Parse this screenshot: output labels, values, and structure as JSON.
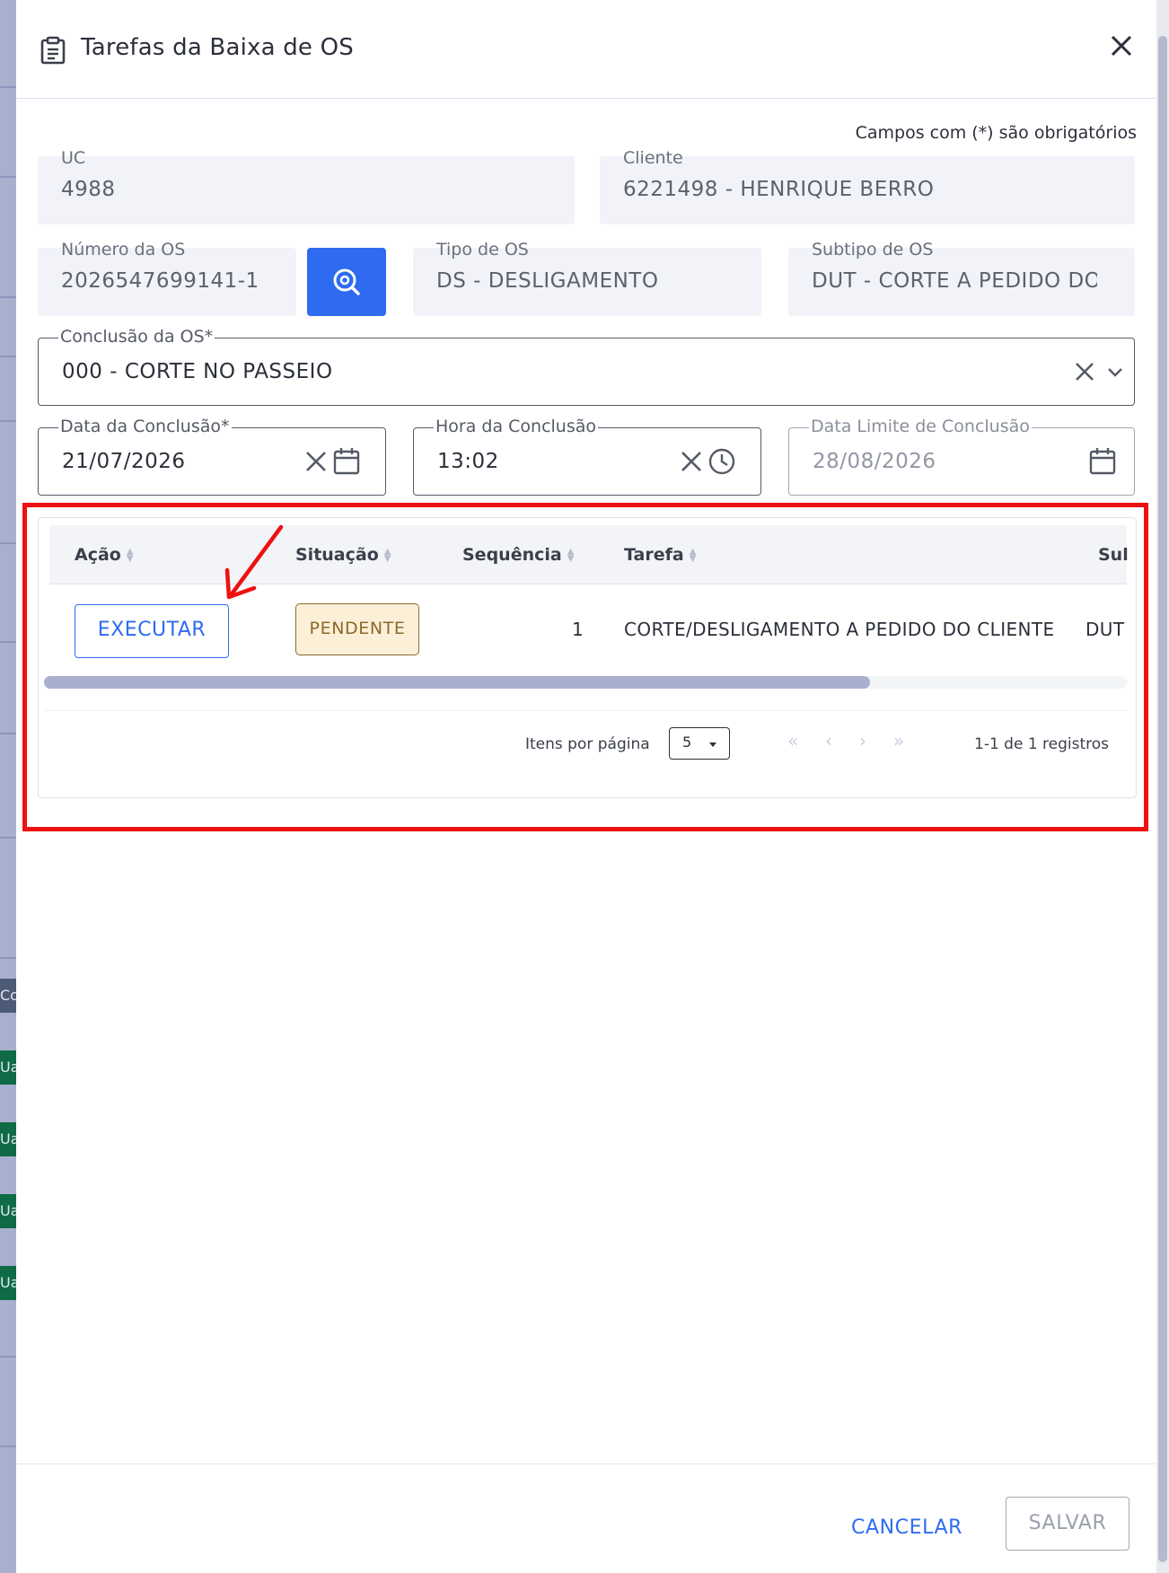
{
  "backdrop": {
    "chips": [
      "Cc",
      "Ua",
      "Ua",
      "Ua",
      "Ua"
    ]
  },
  "dialog": {
    "title": "Tarefas da Baixa de OS",
    "required_note": "Campos com (*) são obrigatórios"
  },
  "fields": {
    "uc": {
      "label": "UC",
      "value": "4988"
    },
    "cliente": {
      "label": "Cliente",
      "value": "6221498 - HENRIQUE BERRO"
    },
    "numero_os": {
      "label": "Número da OS",
      "value": "2026547699141-1"
    },
    "tipo_os": {
      "label": "Tipo de OS",
      "value": "DS - DESLIGAMENTO"
    },
    "subtipo_os": {
      "label": "Subtipo de OS",
      "value": "DUT - CORTE A PEDIDO DO CLIENTE"
    },
    "conclusao_os": {
      "label": "Conclusão da OS*",
      "value": "000 - CORTE NO PASSEIO"
    },
    "data_conclusao": {
      "label": "Data da Conclusão*",
      "value": "21/07/2026"
    },
    "hora_conclusao": {
      "label": "Hora da Conclusão",
      "value": "13:02"
    },
    "data_limite": {
      "label": "Data Limite de Conclusão",
      "value": "28/08/2026"
    }
  },
  "table": {
    "columns": [
      "Ação",
      "Situação",
      "Sequência",
      "Tarefa",
      "Sul"
    ],
    "rows": [
      {
        "action": "EXECUTAR",
        "status": "PENDENTE",
        "sequence": "1",
        "task": "CORTE/DESLIGAMENTO A PEDIDO DO CLIENTE",
        "subtype": "DUT"
      }
    ],
    "pagination": {
      "items_per_page_label": "Itens por página",
      "items_per_page": "5",
      "first": "«",
      "prev": "‹",
      "next": "›",
      "last": "»",
      "range": "1-1 de 1 registros"
    }
  },
  "footer": {
    "cancel_label": "CANCELAR",
    "save_label": "SALVAR"
  },
  "colors": {
    "primary": "#2e6bf0",
    "highlight": "#ee1111",
    "status_pending_bg": "#fcefd8",
    "status_pending_fg": "#8b6a2a"
  }
}
